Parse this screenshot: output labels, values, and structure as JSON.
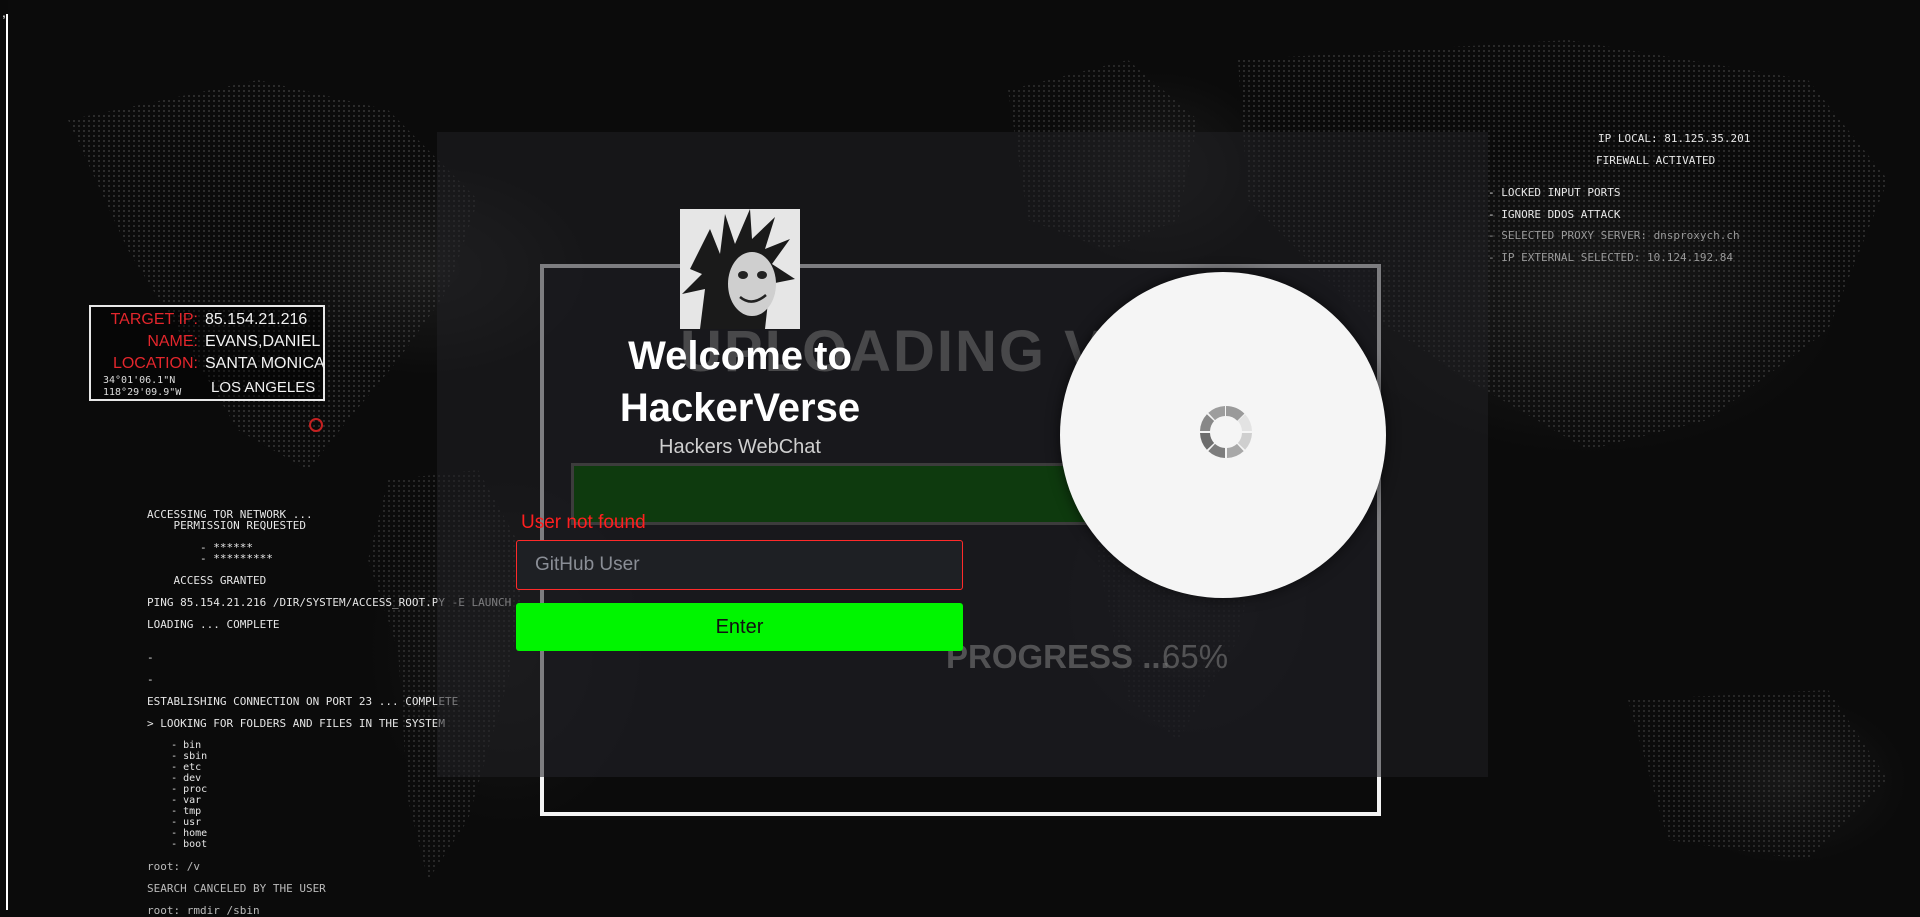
{
  "stray_char": ",",
  "target_card": {
    "ip_label": "TARGET IP:",
    "ip": "85.154.21.216",
    "name_label": "NAME:",
    "name": "EVANS,DANIEL",
    "location_label": "LOCATION:",
    "location": "SANTA MONICA",
    "coord_lat": "34°01'06.1\"N",
    "coord_lon": "118°29'09.9\"W",
    "city": "LOS ANGELES"
  },
  "console": {
    "lines": [
      "ACCESSING TOR NETWORK ...",
      "    PERMISSION REQUESTED",
      "        - ******",
      "        - *********",
      "    ACCESS GRANTED",
      "PING 85.154.21.216 /DIR/SYSTEM/ACCESS_ROOT.PY -E LAUNCH",
      "LOADING ... COMPLETE",
      "-",
      "-",
      "ESTABLISHING CONNECTION ON PORT 23 ... COMPLETE",
      "> LOOKING FOR FOLDERS AND FILES IN THE SYSTEM",
      "    - bin",
      "    - sbin",
      "    - etc",
      "    - dev",
      "    - proc",
      "    - var",
      "    - tmp",
      "    - usr",
      "    - home",
      "    - boot",
      "root: /v",
      "SEARCH CANCELED BY THE USER",
      "root: rmdir /sbin"
    ]
  },
  "net_info": {
    "ip_local": "IP LOCAL: 81.125.35.201",
    "firewall": "FIREWALL ACTIVATED",
    "items": [
      "- LOCKED INPUT PORTS",
      "- IGNORE DDOS ATTACK",
      "- SELECTED PROXY SERVER: dnsproxych.ch",
      "- IP EXTERNAL SELECTED: 10.124.192.84"
    ]
  },
  "upload": {
    "title": "UPLOADING VIRUS",
    "progress_label": "PROGRESS ...",
    "progress_value": "65%",
    "progress_fraction": 0.65
  },
  "login": {
    "welcome_line1": "Welcome to",
    "welcome_line2": "HackerVerse",
    "subtitle": "Hackers WebChat",
    "error": "User not found",
    "input_placeholder": "GitHub User",
    "input_value": "",
    "button_label": "Enter"
  },
  "colors": {
    "button_green": "#00f500",
    "error_red": "#ff1f1f",
    "target_red": "#e3262c"
  },
  "icons": {
    "avatar": "hacker-avatar-image",
    "spinner": "loading-spinner-icon"
  }
}
